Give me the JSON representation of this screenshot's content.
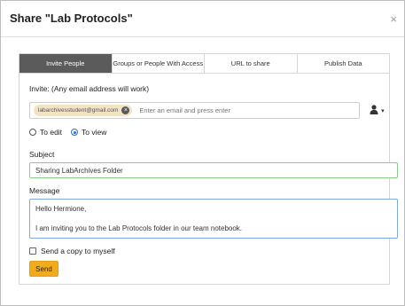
{
  "dialog": {
    "title": "Share \"Lab Protocols\"",
    "close_glyph": "×"
  },
  "tabs": [
    {
      "label": "Invite People",
      "active": true
    },
    {
      "label": "Groups or People With Access",
      "active": false
    },
    {
      "label": "URL to share",
      "active": false
    },
    {
      "label": "Publish Data",
      "active": false
    }
  ],
  "invite": {
    "label": "Invite: (Any email address will work)",
    "chip_email": "labarchivesstudent@gmail.com",
    "chip_remove_glyph": "×",
    "placeholder": "Enter an email and press enter",
    "contacts_icon": "person-icon",
    "contacts_caret": "▾"
  },
  "permissions": {
    "options": [
      {
        "label": "To edit",
        "checked": false
      },
      {
        "label": "To view",
        "checked": true
      }
    ]
  },
  "subject": {
    "label": "Subject",
    "value": "Sharing LabArchives Folder"
  },
  "message": {
    "label": "Message",
    "line1": "Hello Hermione,",
    "line2": "I am inviting you to the Lab Protocols folder in our team notebook."
  },
  "copy": {
    "label": "Send a copy to myself",
    "checked": false
  },
  "send_label": "Send",
  "colors": {
    "active_tab": "#5b5b5b",
    "send_button": "#f1ac1c",
    "chip": "#f3e3c5",
    "radio_checked": "#2b6fd6"
  }
}
